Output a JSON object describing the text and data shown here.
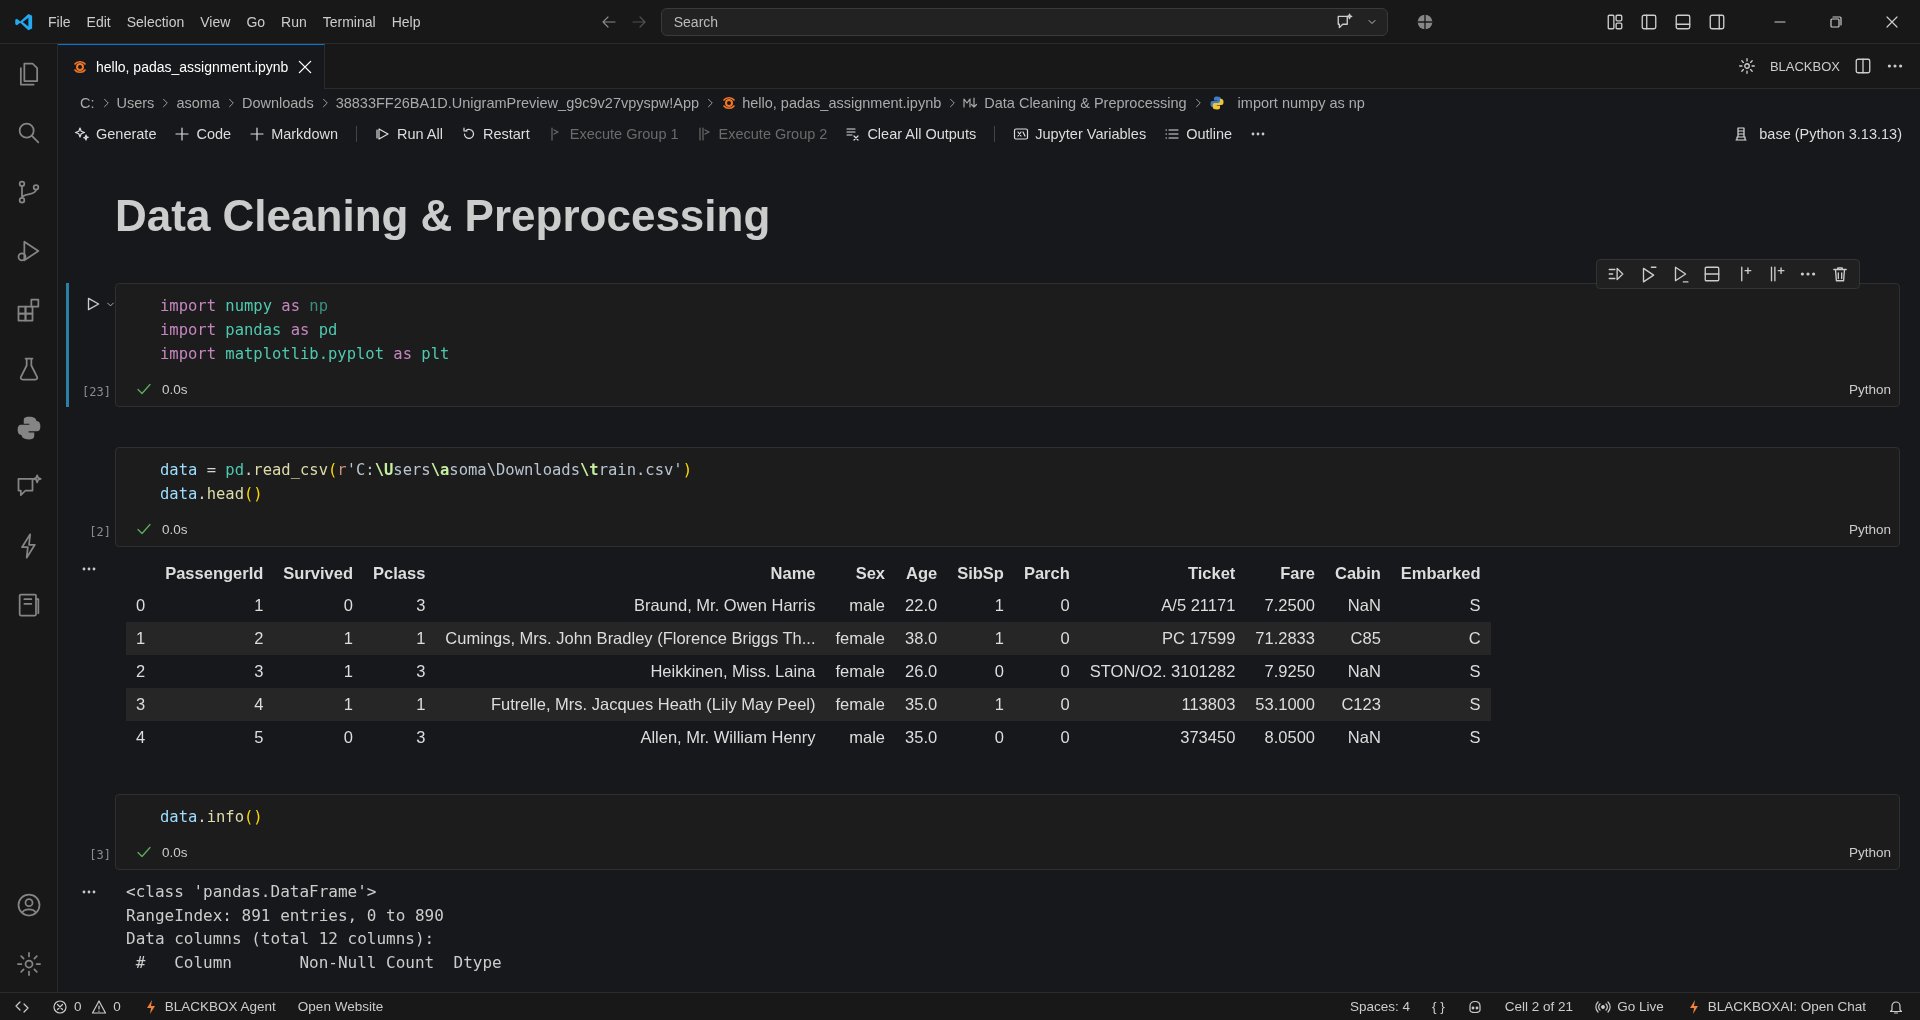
{
  "menu": [
    "File",
    "Edit",
    "Selection",
    "View",
    "Go",
    "Run",
    "Terminal",
    "Help"
  ],
  "search": {
    "placeholder": "Search"
  },
  "tabs": [
    {
      "label": "hello, padas_assignment.ipynb",
      "selected": true
    }
  ],
  "editor_actions": {
    "extension": "BLACKBOX"
  },
  "breadcrumb": [
    {
      "label": "C:",
      "kind": "folder"
    },
    {
      "label": "Users",
      "kind": "folder"
    },
    {
      "label": "asoma",
      "kind": "folder"
    },
    {
      "label": "Downloads",
      "kind": "folder"
    },
    {
      "label": "38833FF26BA1D.UnigramPreview_g9c9v27vpyspw!App",
      "kind": "folder"
    },
    {
      "label": "hello, padas_assignment.ipynb",
      "kind": "notebook"
    },
    {
      "label": "Data Cleaning & Preprocessing",
      "kind": "markdown"
    },
    {
      "label": "import numpy as np",
      "kind": "python"
    }
  ],
  "toolbar": [
    {
      "label": "Generate",
      "kind": "generate",
      "disabled": false,
      "separator": false
    },
    {
      "label": "Code",
      "kind": "add",
      "disabled": false,
      "separator": false
    },
    {
      "label": "Markdown",
      "kind": "add",
      "disabled": false,
      "separator": false
    },
    {
      "label": "Run All",
      "kind": "run-all",
      "disabled": false,
      "separator": true
    },
    {
      "label": "Restart",
      "kind": "restart",
      "disabled": false,
      "separator": false
    },
    {
      "label": "Execute Group 1",
      "kind": "group-one",
      "disabled": true,
      "separator": false
    },
    {
      "label": "Execute Group 2",
      "kind": "group-two",
      "disabled": true,
      "separator": false
    },
    {
      "label": "Clear All Outputs",
      "kind": "clear",
      "disabled": false,
      "separator": false
    },
    {
      "label": "Jupyter Variables",
      "kind": "variables",
      "disabled": false,
      "separator": true
    },
    {
      "label": "Outline",
      "kind": "outline",
      "disabled": false,
      "separator": false
    }
  ],
  "kernel": "base (Python 3.13.13)",
  "heading": "Data Cleaning & Preprocessing",
  "cells": [
    {
      "selected": true,
      "count": "[23]",
      "status": "0.0s",
      "language": "Python",
      "code": [
        [
          {
            "kind": "keyword",
            "text": "import "
          },
          {
            "kind": "module",
            "text": "numpy "
          },
          {
            "kind": "keyword",
            "text": "as "
          },
          {
            "kind": "unused",
            "text": "np"
          }
        ],
        [
          {
            "kind": "keyword",
            "text": "import "
          },
          {
            "kind": "module",
            "text": "pandas "
          },
          {
            "kind": "keyword",
            "text": "as "
          },
          {
            "kind": "module",
            "text": "pd"
          }
        ],
        [
          {
            "kind": "keyword",
            "text": "import "
          },
          {
            "kind": "module",
            "text": "matplotlib.pyplot "
          },
          {
            "kind": "keyword",
            "text": "as "
          },
          {
            "kind": "module",
            "text": "plt"
          }
        ]
      ]
    },
    {
      "selected": false,
      "count": "[2]",
      "status": "0.0s",
      "language": "Python",
      "code": [
        [
          {
            "kind": "variable",
            "text": "data"
          },
          {
            "kind": "plain",
            "text": " = "
          },
          {
            "kind": "module",
            "text": "pd"
          },
          {
            "kind": "plain",
            "text": "."
          },
          {
            "kind": "function",
            "text": "read_csv"
          },
          {
            "kind": "paren",
            "text": "("
          },
          {
            "kind": "prefix",
            "text": "r"
          },
          {
            "kind": "string",
            "text": "'C:"
          },
          {
            "kind": "escape",
            "text": "\\U"
          },
          {
            "kind": "string",
            "text": "sers"
          },
          {
            "kind": "escape",
            "text": "\\a"
          },
          {
            "kind": "string",
            "text": "soma\\Downloads"
          },
          {
            "kind": "escape",
            "text": "\\t"
          },
          {
            "kind": "string",
            "text": "rain.csv'"
          },
          {
            "kind": "paren",
            "text": ")"
          }
        ],
        [
          {
            "kind": "variable",
            "text": "data"
          },
          {
            "kind": "plain",
            "text": "."
          },
          {
            "kind": "function",
            "text": "head"
          },
          {
            "kind": "paren",
            "text": "()"
          }
        ]
      ],
      "output": {
        "kind": "table",
        "columns": [
          "PassengerId",
          "Survived",
          "Pclass",
          "Name",
          "Sex",
          "Age",
          "SibSp",
          "Parch",
          "Ticket",
          "Fare",
          "Cabin",
          "Embarked"
        ],
        "rows": [
          {
            "index": "0",
            "cells": [
              "1",
              "0",
              "3",
              "Braund, Mr. Owen Harris",
              "male",
              "22.0",
              "1",
              "0",
              "A/5 21171",
              "7.2500",
              "NaN",
              "S"
            ]
          },
          {
            "index": "1",
            "cells": [
              "2",
              "1",
              "1",
              "Cumings, Mrs. John Bradley (Florence Briggs Th...",
              "female",
              "38.0",
              "1",
              "0",
              "PC 17599",
              "71.2833",
              "C85",
              "C"
            ]
          },
          {
            "index": "2",
            "cells": [
              "3",
              "1",
              "3",
              "Heikkinen, Miss. Laina",
              "female",
              "26.0",
              "0",
              "0",
              "STON/O2. 3101282",
              "7.9250",
              "NaN",
              "S"
            ]
          },
          {
            "index": "3",
            "cells": [
              "4",
              "1",
              "1",
              "Futrelle, Mrs. Jacques Heath (Lily May Peel)",
              "female",
              "35.0",
              "1",
              "0",
              "113803",
              "53.1000",
              "C123",
              "S"
            ]
          },
          {
            "index": "4",
            "cells": [
              "5",
              "0",
              "3",
              "Allen, Mr. William Henry",
              "male",
              "35.0",
              "0",
              "0",
              "373450",
              "8.0500",
              "NaN",
              "S"
            ]
          }
        ]
      }
    },
    {
      "selected": false,
      "count": "[3]",
      "status": "0.0s",
      "language": "Python",
      "code": [
        [
          {
            "kind": "variable",
            "text": "data"
          },
          {
            "kind": "plain",
            "text": "."
          },
          {
            "kind": "function",
            "text": "info"
          },
          {
            "kind": "paren",
            "text": "()"
          }
        ]
      ],
      "output": {
        "kind": "text",
        "lines": [
          "<class 'pandas.DataFrame'>",
          "RangeIndex: 891 entries, 0 to 890",
          "Data columns (total 12 columns):",
          " #   Column       Non-Null Count  Dtype"
        ]
      }
    }
  ],
  "status_bar": {
    "left": [
      {
        "kind": "remote"
      },
      {
        "kind": "problems",
        "errors": "0",
        "warnings": "0"
      },
      {
        "kind": "bolt",
        "label": "BLACKBOX Agent"
      },
      {
        "kind": "text",
        "label": "Open Website"
      }
    ],
    "right": [
      {
        "kind": "text",
        "label": "Spaces: 4"
      },
      {
        "kind": "text",
        "label": "{ }"
      },
      {
        "kind": "copilot"
      },
      {
        "kind": "text",
        "label": "Cell 2 of 21"
      },
      {
        "kind": "broadcast",
        "label": "Go Live"
      },
      {
        "kind": "bolt",
        "label": "BLACKBOXAI: Open Chat"
      },
      {
        "kind": "bell"
      }
    ]
  }
}
